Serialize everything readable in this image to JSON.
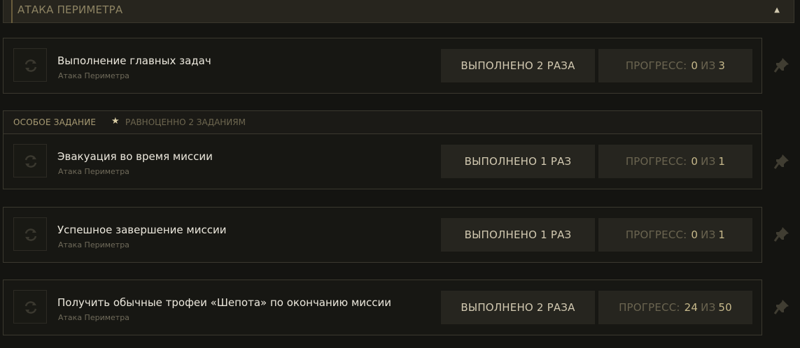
{
  "section": {
    "title": "АТАКА ПЕРИМЕТРА",
    "collapse_icon": "▲"
  },
  "special": {
    "label": "ОСОБОЕ ЗАДАНИЕ",
    "star": "★",
    "equiv": "РАВНОЦЕННО 2 ЗАДАНИЯМ"
  },
  "progress_label": "ПРОГРЕСС:",
  "progress_of": "ИЗ",
  "tasks": [
    {
      "title": "Выполнение главных задач",
      "subtitle": "Атака Периметра",
      "completed": "ВЫПОЛНЕНО 2 РАЗА",
      "progress_current": "0",
      "progress_total": "3"
    },
    {
      "title": "Эвакуация во время миссии",
      "subtitle": "Атака Периметра",
      "completed": "ВЫПОЛНЕНО 1 РАЗ",
      "progress_current": "0",
      "progress_total": "1"
    },
    {
      "title": "Успешное завершение миссии",
      "subtitle": "Атака Периметра",
      "completed": "ВЫПОЛНЕНО 1 РАЗ",
      "progress_current": "0",
      "progress_total": "1"
    },
    {
      "title": "Получить обычные трофеи «Шепота» по окончанию миссии",
      "subtitle": "Атака Периметра",
      "completed": "ВЫПОЛНЕНО 2 РАЗА",
      "progress_current": "24",
      "progress_total": "50"
    }
  ],
  "colors": {
    "background": "#141411",
    "card_border": "#3b392f",
    "button_bg": "#26251f",
    "accent_gold": "#c7b98b"
  },
  "icons": {
    "refresh": "refresh-icon",
    "pin": "pin-icon",
    "star": "star-icon",
    "collapse": "chevron-up-icon"
  }
}
